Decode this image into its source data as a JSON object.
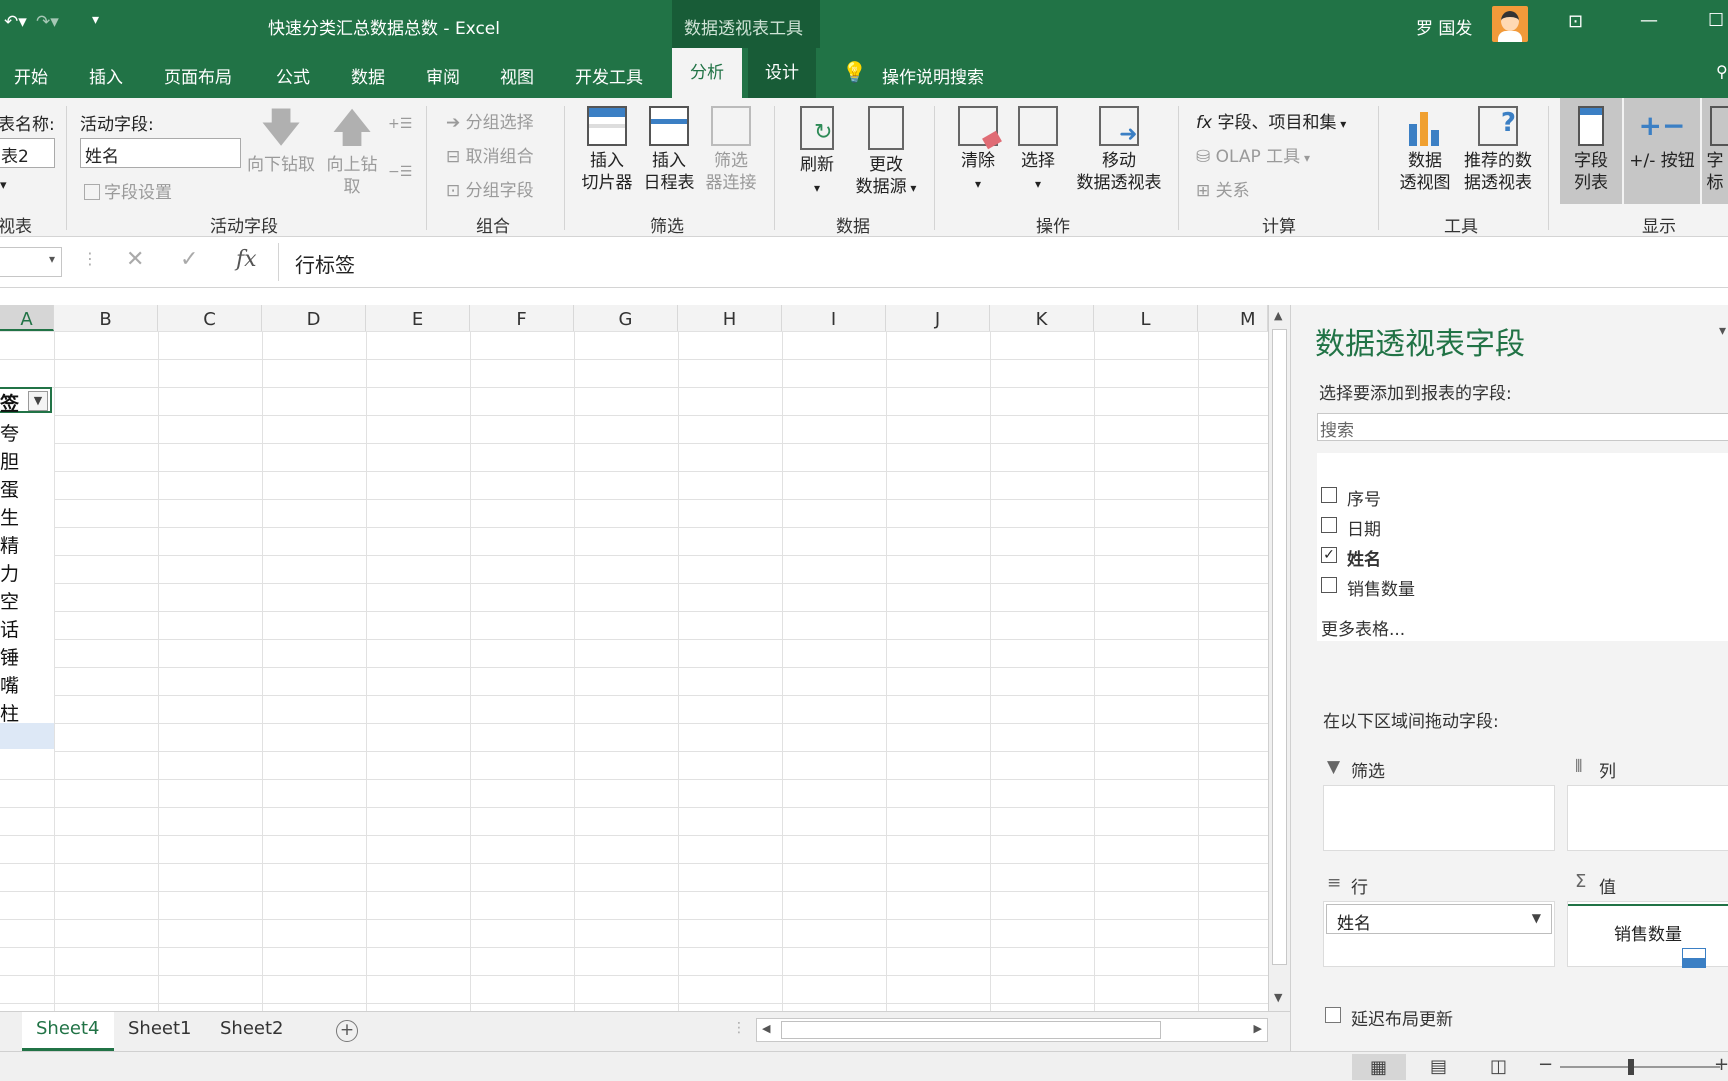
{
  "window": {
    "title": "快速分类汇总数据总数  -  Excel",
    "context_tool": "数据透视表工具",
    "user": "罗 国发"
  },
  "tabs": [
    {
      "label": "开始"
    },
    {
      "label": "插入"
    },
    {
      "label": "页面布局"
    },
    {
      "label": "公式"
    },
    {
      "label": "数据"
    },
    {
      "label": "审阅"
    },
    {
      "label": "视图"
    },
    {
      "label": "开发工具"
    },
    {
      "label": "分析"
    },
    {
      "label": "设计"
    }
  ],
  "tell_me": "操作说明搜索",
  "ribbon": {
    "pivot_name_label": "表名称:",
    "pivot_name_value": "表2",
    "pivot_group": "视表",
    "active_field_label": "活动字段:",
    "active_field_value": "姓名",
    "field_settings": "字段设置",
    "drill_down": "向下钻取",
    "drill_up_1": "向上钻",
    "drill_up_2": "取",
    "active_field_group": "活动字段",
    "group_selection": "分组选择",
    "ungroup": "取消组合",
    "group_field": "分组字段",
    "group_group": "组合",
    "insert_slicer_1": "插入",
    "insert_slicer_2": "切片器",
    "insert_timeline_1": "插入",
    "insert_timeline_2": "日程表",
    "filter_conn_1": "筛选",
    "filter_conn_2": "器连接",
    "filter_group": "筛选",
    "refresh": "刷新",
    "change_source_1": "更改",
    "change_source_2": "数据源",
    "data_group": "数据",
    "clear": "清除",
    "select": "选择",
    "move_1": "移动",
    "move_2": "数据透视表",
    "actions_group": "操作",
    "fields_items": "字段、项目和集",
    "olap": "OLAP 工具",
    "relations": "关系",
    "calc_group": "计算",
    "pivotchart_1": "数据",
    "pivotchart_2": "透视图",
    "recommended_1": "推荐的数",
    "recommended_2": "据透视表",
    "tools_group": "工具",
    "field_list_1": "字段",
    "field_list_2": "列表",
    "buttons": "+/- 按钮",
    "headers_1": "字",
    "headers_2": "标",
    "show_group": "显示"
  },
  "formula_bar": {
    "content": "行标签"
  },
  "columns": [
    "A",
    "B",
    "C",
    "D",
    "E",
    "F",
    "G",
    "H",
    "I",
    "J",
    "K",
    "L",
    "M"
  ],
  "cells": {
    "header": "签",
    "rows": [
      "夸",
      "胆",
      "蛋",
      "生",
      "精",
      "力",
      "空",
      "话",
      "锤",
      "嘴",
      "柱"
    ]
  },
  "sheets": [
    {
      "label": "Sheet4"
    },
    {
      "label": "Sheet1"
    },
    {
      "label": "Sheet2"
    }
  ],
  "pane": {
    "title": "数据透视表字段",
    "subtitle": "选择要添加到报表的字段:",
    "search_placeholder": "搜索",
    "fields": [
      {
        "label": "序号",
        "checked": false
      },
      {
        "label": "日期",
        "checked": false
      },
      {
        "label": "姓名",
        "checked": true
      },
      {
        "label": "销售数量",
        "checked": false
      }
    ],
    "more_tables": "更多表格...",
    "drag_label": "在以下区域间拖动字段:",
    "filter_label": "筛选",
    "column_label": "列",
    "row_label": "行",
    "value_label": "值",
    "row_item": "姓名",
    "value_item": "销售数量",
    "defer_label": "延迟布局更新"
  }
}
